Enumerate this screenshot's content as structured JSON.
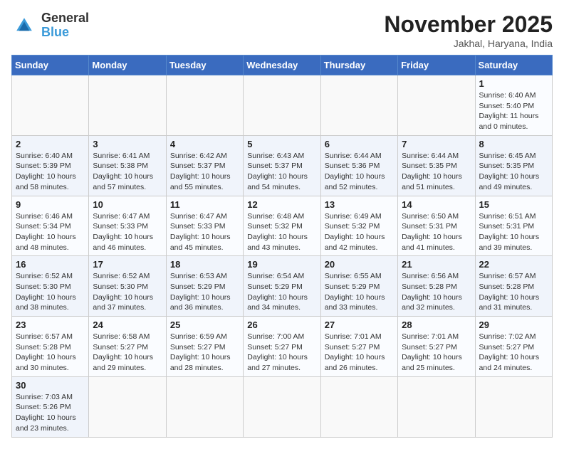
{
  "header": {
    "logo_general": "General",
    "logo_blue": "Blue",
    "month_title": "November 2025",
    "subtitle": "Jakhal, Haryana, India"
  },
  "weekdays": [
    "Sunday",
    "Monday",
    "Tuesday",
    "Wednesday",
    "Thursday",
    "Friday",
    "Saturday"
  ],
  "weeks": [
    [
      {
        "day": "",
        "info": ""
      },
      {
        "day": "",
        "info": ""
      },
      {
        "day": "",
        "info": ""
      },
      {
        "day": "",
        "info": ""
      },
      {
        "day": "",
        "info": ""
      },
      {
        "day": "",
        "info": ""
      },
      {
        "day": "1",
        "info": "Sunrise: 6:40 AM\nSunset: 5:40 PM\nDaylight: 11 hours\nand 0 minutes."
      }
    ],
    [
      {
        "day": "2",
        "info": "Sunrise: 6:40 AM\nSunset: 5:39 PM\nDaylight: 10 hours\nand 58 minutes."
      },
      {
        "day": "3",
        "info": "Sunrise: 6:41 AM\nSunset: 5:38 PM\nDaylight: 10 hours\nand 57 minutes."
      },
      {
        "day": "4",
        "info": "Sunrise: 6:42 AM\nSunset: 5:37 PM\nDaylight: 10 hours\nand 55 minutes."
      },
      {
        "day": "5",
        "info": "Sunrise: 6:43 AM\nSunset: 5:37 PM\nDaylight: 10 hours\nand 54 minutes."
      },
      {
        "day": "6",
        "info": "Sunrise: 6:44 AM\nSunset: 5:36 PM\nDaylight: 10 hours\nand 52 minutes."
      },
      {
        "day": "7",
        "info": "Sunrise: 6:44 AM\nSunset: 5:35 PM\nDaylight: 10 hours\nand 51 minutes."
      },
      {
        "day": "8",
        "info": "Sunrise: 6:45 AM\nSunset: 5:35 PM\nDaylight: 10 hours\nand 49 minutes."
      }
    ],
    [
      {
        "day": "9",
        "info": "Sunrise: 6:46 AM\nSunset: 5:34 PM\nDaylight: 10 hours\nand 48 minutes."
      },
      {
        "day": "10",
        "info": "Sunrise: 6:47 AM\nSunset: 5:33 PM\nDaylight: 10 hours\nand 46 minutes."
      },
      {
        "day": "11",
        "info": "Sunrise: 6:47 AM\nSunset: 5:33 PM\nDaylight: 10 hours\nand 45 minutes."
      },
      {
        "day": "12",
        "info": "Sunrise: 6:48 AM\nSunset: 5:32 PM\nDaylight: 10 hours\nand 43 minutes."
      },
      {
        "day": "13",
        "info": "Sunrise: 6:49 AM\nSunset: 5:32 PM\nDaylight: 10 hours\nand 42 minutes."
      },
      {
        "day": "14",
        "info": "Sunrise: 6:50 AM\nSunset: 5:31 PM\nDaylight: 10 hours\nand 41 minutes."
      },
      {
        "day": "15",
        "info": "Sunrise: 6:51 AM\nSunset: 5:31 PM\nDaylight: 10 hours\nand 39 minutes."
      }
    ],
    [
      {
        "day": "16",
        "info": "Sunrise: 6:52 AM\nSunset: 5:30 PM\nDaylight: 10 hours\nand 38 minutes."
      },
      {
        "day": "17",
        "info": "Sunrise: 6:52 AM\nSunset: 5:30 PM\nDaylight: 10 hours\nand 37 minutes."
      },
      {
        "day": "18",
        "info": "Sunrise: 6:53 AM\nSunset: 5:29 PM\nDaylight: 10 hours\nand 36 minutes."
      },
      {
        "day": "19",
        "info": "Sunrise: 6:54 AM\nSunset: 5:29 PM\nDaylight: 10 hours\nand 34 minutes."
      },
      {
        "day": "20",
        "info": "Sunrise: 6:55 AM\nSunset: 5:29 PM\nDaylight: 10 hours\nand 33 minutes."
      },
      {
        "day": "21",
        "info": "Sunrise: 6:56 AM\nSunset: 5:28 PM\nDaylight: 10 hours\nand 32 minutes."
      },
      {
        "day": "22",
        "info": "Sunrise: 6:57 AM\nSunset: 5:28 PM\nDaylight: 10 hours\nand 31 minutes."
      }
    ],
    [
      {
        "day": "23",
        "info": "Sunrise: 6:57 AM\nSunset: 5:28 PM\nDaylight: 10 hours\nand 30 minutes."
      },
      {
        "day": "24",
        "info": "Sunrise: 6:58 AM\nSunset: 5:27 PM\nDaylight: 10 hours\nand 29 minutes."
      },
      {
        "day": "25",
        "info": "Sunrise: 6:59 AM\nSunset: 5:27 PM\nDaylight: 10 hours\nand 28 minutes."
      },
      {
        "day": "26",
        "info": "Sunrise: 7:00 AM\nSunset: 5:27 PM\nDaylight: 10 hours\nand 27 minutes."
      },
      {
        "day": "27",
        "info": "Sunrise: 7:01 AM\nSunset: 5:27 PM\nDaylight: 10 hours\nand 26 minutes."
      },
      {
        "day": "28",
        "info": "Sunrise: 7:01 AM\nSunset: 5:27 PM\nDaylight: 10 hours\nand 25 minutes."
      },
      {
        "day": "29",
        "info": "Sunrise: 7:02 AM\nSunset: 5:27 PM\nDaylight: 10 hours\nand 24 minutes."
      }
    ],
    [
      {
        "day": "30",
        "info": "Sunrise: 7:03 AM\nSunset: 5:26 PM\nDaylight: 10 hours\nand 23 minutes."
      },
      {
        "day": "",
        "info": ""
      },
      {
        "day": "",
        "info": ""
      },
      {
        "day": "",
        "info": ""
      },
      {
        "day": "",
        "info": ""
      },
      {
        "day": "",
        "info": ""
      },
      {
        "day": "",
        "info": ""
      }
    ]
  ]
}
